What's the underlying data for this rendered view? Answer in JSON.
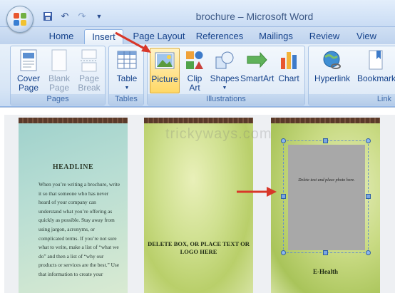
{
  "window": {
    "title": "brochure – Microsoft Word"
  },
  "qat": {
    "icons": [
      "save-icon",
      "undo-icon",
      "redo-icon",
      "customize-icon"
    ]
  },
  "tabs": [
    {
      "label": "Home"
    },
    {
      "label": "Insert",
      "active": true
    },
    {
      "label": "Page Layout"
    },
    {
      "label": "References"
    },
    {
      "label": "Mailings"
    },
    {
      "label": "Review"
    },
    {
      "label": "View"
    }
  ],
  "ribbon": {
    "pages": {
      "label": "Pages",
      "cover_page": "Cover\nPage",
      "blank_page": "Blank\nPage",
      "page_break": "Page\nBreak"
    },
    "tables": {
      "label": "Tables",
      "table": "Table"
    },
    "illustrations": {
      "label": "Illustrations",
      "picture": "Picture",
      "clip_art": "Clip\nArt",
      "shapes": "Shapes",
      "smartart": "SmartArt",
      "chart": "Chart"
    },
    "links": {
      "label": "Link",
      "hyperlink": "Hyperlink",
      "bookmark": "Bookmark"
    }
  },
  "document": {
    "watermark": "trickyways.com",
    "panel1": {
      "headline": "HEADLINE",
      "body": "When you’re writing a brochure, write it so that someone who has never heard of your company can understand what you’re offering as quickly as possible. Stay away from using jargon, acronyms, or complicated terms. If you’re not sure what to write, make a list of “what we do” and then a list of “why our products or services are the best.” Use that information to create your"
    },
    "panel2": {
      "placeholder": "DELETE BOX, OR PLACE TEXT OR LOGO HERE"
    },
    "panel3": {
      "photo_hint": "Delete text and place photo here.",
      "caption": "E-Health"
    }
  },
  "colors": {
    "accent_red": "#d8372a",
    "ribbon_blue": "#15428b"
  }
}
